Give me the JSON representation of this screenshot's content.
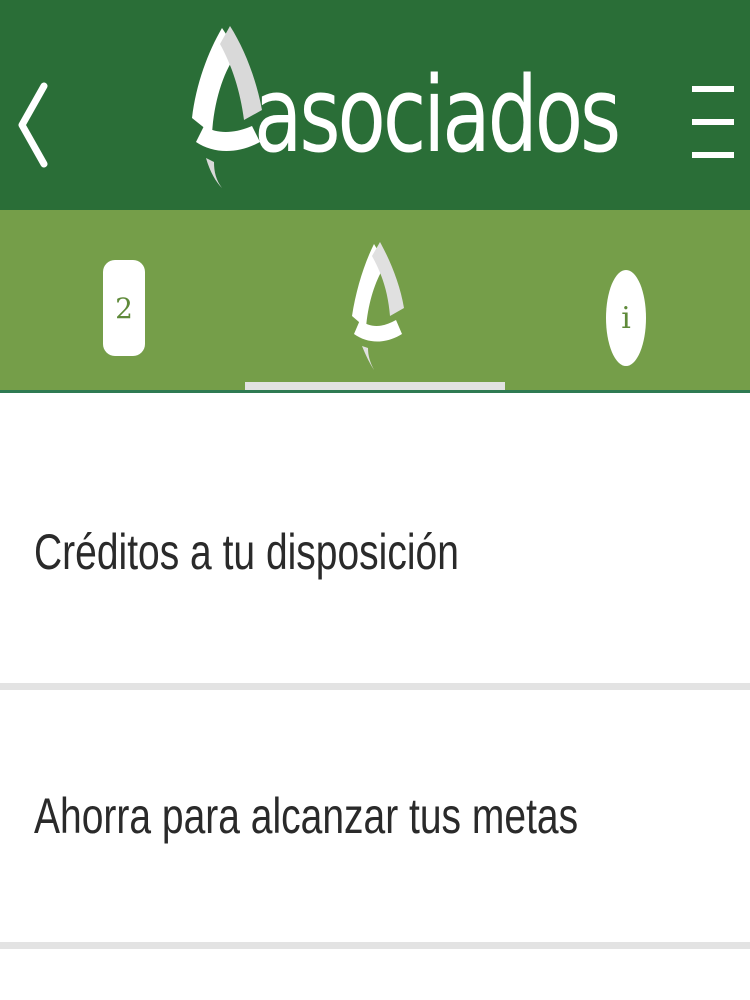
{
  "header": {
    "logo_text": "asociados",
    "back_icon": "chevron-left-icon",
    "menu_icon": "hamburger-menu-icon"
  },
  "tabs": [
    {
      "icon": "badge-icon",
      "label": "2"
    },
    {
      "icon": "brand-logo-icon",
      "label": "",
      "selected": true
    },
    {
      "icon": "info-icon",
      "label": "i"
    }
  ],
  "list": {
    "items": [
      {
        "label": "Créditos a tu disposición"
      },
      {
        "label": "Ahorra para alcanzar tus metas"
      }
    ]
  },
  "colors": {
    "header_bg": "#2a6e37",
    "tabbar_bg": "#759e49",
    "indicator": "#e2e2e2",
    "text": "#2a2a2a"
  }
}
